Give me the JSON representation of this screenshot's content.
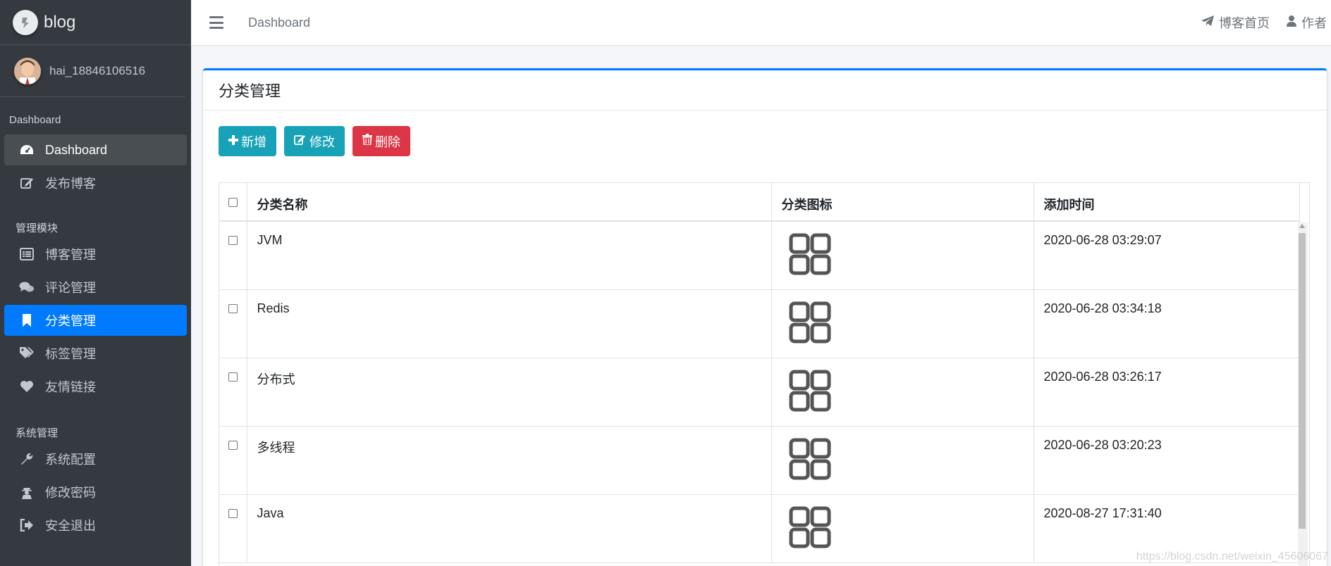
{
  "brand": {
    "name": "blog"
  },
  "user": {
    "name": "hai_18846106516"
  },
  "sidebar": {
    "sections": [
      {
        "header": "Dashboard",
        "items": [
          {
            "label": "Dashboard",
            "icon": "tachometer-icon"
          },
          {
            "label": "发布博客",
            "icon": "edit-icon"
          }
        ]
      },
      {
        "header": "管理模块",
        "items": [
          {
            "label": "博客管理",
            "icon": "list-alt-icon"
          },
          {
            "label": "评论管理",
            "icon": "comments-icon"
          },
          {
            "label": "分类管理",
            "icon": "bookmark-icon"
          },
          {
            "label": "标签管理",
            "icon": "tags-icon"
          },
          {
            "label": "友情链接",
            "icon": "heart-icon"
          }
        ]
      },
      {
        "header": "系统管理",
        "items": [
          {
            "label": "系统配置",
            "icon": "wrench-icon"
          },
          {
            "label": "修改密码",
            "icon": "user-secret-icon"
          },
          {
            "label": "安全退出",
            "icon": "sign-out-icon"
          }
        ]
      }
    ]
  },
  "topbar": {
    "breadcrumb": "Dashboard",
    "links": [
      {
        "label": "博客首页",
        "icon": "paper-plane-icon"
      },
      {
        "label": "作者",
        "icon": "user-icon"
      }
    ]
  },
  "card": {
    "title": "分类管理",
    "buttons": {
      "add": "新增",
      "edit": "修改",
      "delete": "删除"
    }
  },
  "table": {
    "headers": [
      "分类名称",
      "分类图标",
      "添加时间"
    ],
    "rows": [
      {
        "name": "JVM",
        "icon": "th-large-icon",
        "time": "2020-06-28 03:29:07"
      },
      {
        "name": "Redis",
        "icon": "th-large-icon",
        "time": "2020-06-28 03:34:18"
      },
      {
        "name": "分布式",
        "icon": "th-large-icon",
        "time": "2020-06-28 03:26:17"
      },
      {
        "name": "多线程",
        "icon": "th-large-icon",
        "time": "2020-06-28 03:20:23"
      },
      {
        "name": "Java",
        "icon": "th-large-icon",
        "time": "2020-08-27 17:31:40"
      }
    ]
  },
  "watermark": "https://blog.csdn.net/weixin_45606067",
  "colors": {
    "sidebar": "#343a40",
    "primary": "#007bff",
    "info": "#17a2b8",
    "danger": "#dc3545"
  }
}
